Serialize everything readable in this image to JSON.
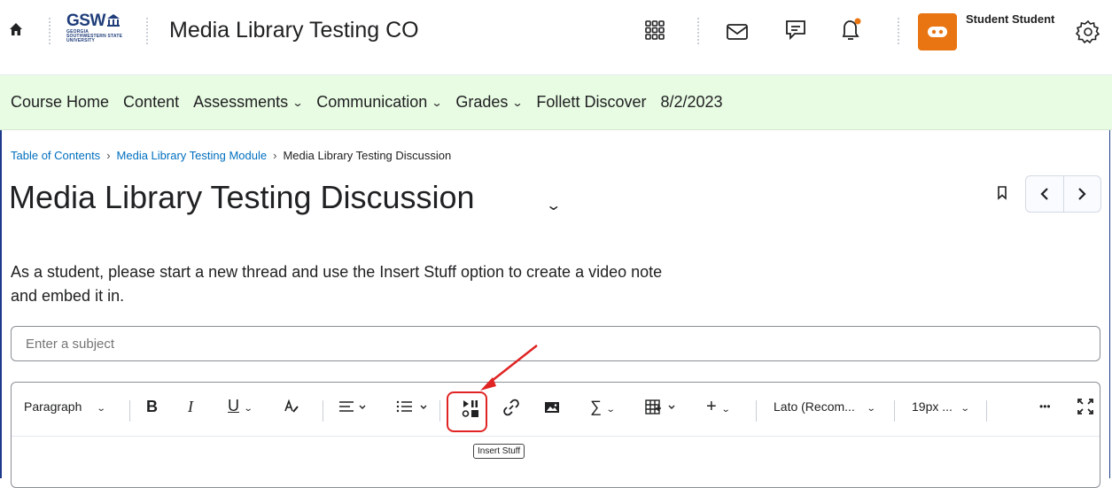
{
  "header": {
    "logo_text": "GSW",
    "logo_subtext": "GEORGIA SOUTHWESTERN STATE UNIVERSITY",
    "course_title": "Media Library Testing CO",
    "username": "Student Student",
    "avatar_color": "#e87511"
  },
  "navbar": {
    "background": "#e8fbe3",
    "items": [
      {
        "label": "Course Home"
      },
      {
        "label": "Content"
      },
      {
        "label": "Assessments"
      },
      {
        "label": "Communication"
      },
      {
        "label": "Grades"
      },
      {
        "label": "Follett Discover"
      },
      {
        "label": "8/2/2023"
      }
    ]
  },
  "breadcrumb": {
    "items": [
      "Table of Contents",
      "Media Library Testing Module",
      "Media Library Testing Discussion"
    ],
    "separator": "›"
  },
  "page": {
    "title": "Media Library Testing Discussion",
    "description": "As a student, please start a new thread and use the Insert Stuff option to create a video note and embed it in."
  },
  "form": {
    "subject_placeholder": "Enter a subject"
  },
  "toolbar": {
    "paragraph_label": "Paragraph",
    "font_label": "Lato (Recom...",
    "size_label": "19px ...",
    "more_label": "•••",
    "insert_stuff_tooltip": "Insert Stuff"
  },
  "annotation": {
    "color": "#e02424"
  }
}
